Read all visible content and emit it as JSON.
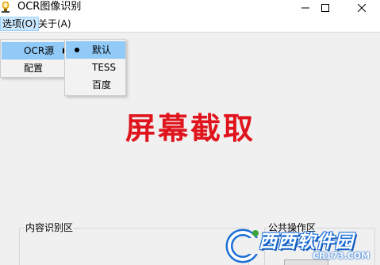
{
  "window": {
    "title": "OCR图像识别",
    "controls": [
      "minimize-icon",
      "maximize-icon",
      "close-icon"
    ]
  },
  "menubar": {
    "items": [
      {
        "label": "选项(O)",
        "active": true
      },
      {
        "label": "关于(A)",
        "active": false
      }
    ]
  },
  "options_menu": {
    "items": [
      {
        "label": "OCR源",
        "has_submenu": true,
        "highlighted": true
      },
      {
        "label": "配置",
        "has_submenu": false,
        "highlighted": false
      }
    ]
  },
  "ocr_source_submenu": {
    "items": [
      {
        "label": "默认",
        "checked": true
      },
      {
        "label": "TESS",
        "checked": false
      },
      {
        "label": "百度",
        "checked": false
      }
    ]
  },
  "main": {
    "capture_label": "屏幕截取",
    "capture_color": "#e0141c"
  },
  "groups": {
    "content_title": "内容识别区",
    "public_title": "公共操作区"
  },
  "watermark": {
    "brand": "西西软件园",
    "url": "CR173.COM"
  },
  "colors": {
    "menu_highlight": "#91c9f7",
    "menubar_active": "#cce8ff"
  }
}
